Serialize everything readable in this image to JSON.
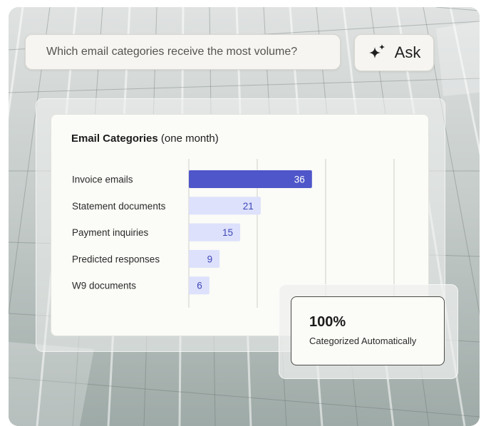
{
  "search": {
    "query": "Which email categories receive the most volume?",
    "ask_label": "Ask",
    "ask_icon": "sparkle-icon"
  },
  "chart": {
    "title_bold": "Email Categories",
    "title_rest": " (one month)"
  },
  "chart_data": {
    "type": "bar",
    "orientation": "horizontal",
    "title": "Email Categories (one month)",
    "categories": [
      "Invoice emails",
      "Statement documents",
      "Payment inquiries",
      "Predicted responses",
      "W9 documents"
    ],
    "values": [
      36,
      21,
      15,
      9,
      6
    ],
    "highlight_index": 0,
    "xlim": [
      0,
      60
    ],
    "grid": "vertical",
    "colors": {
      "highlight_bar": "#4f56c9",
      "bar": "#dde1fb",
      "highlight_text": "#ffffff",
      "bar_text": "#3f47b8",
      "grid": "#cfcfc8",
      "label": "#2a2a2a"
    }
  },
  "stat": {
    "value": "100%",
    "label": "Categorized Automatically"
  }
}
